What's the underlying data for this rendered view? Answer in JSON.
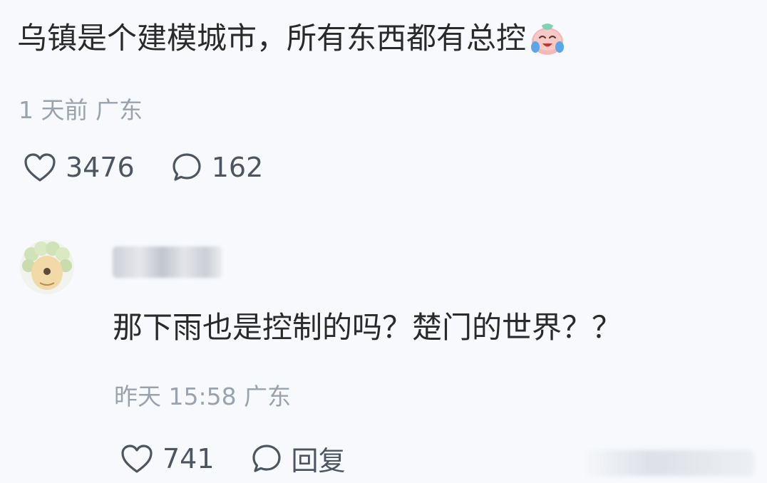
{
  "main_comment": {
    "text": "乌镇是个建模城市，所有东西都有总控",
    "emoji": "crying-laughing-emoji-icon",
    "time": "1 天前",
    "location": "广东",
    "likes": "3476",
    "comments": "162"
  },
  "reply": {
    "text": "那下雨也是控制的吗？楚门的世界？？",
    "time": "昨天 15:58",
    "location": "广东",
    "likes": "741",
    "reply_label": "回复"
  },
  "colors": {
    "background": "#f7f9fc",
    "text": "#2a2a2a",
    "meta": "#9aa3ad",
    "icon": "#4c5560"
  }
}
